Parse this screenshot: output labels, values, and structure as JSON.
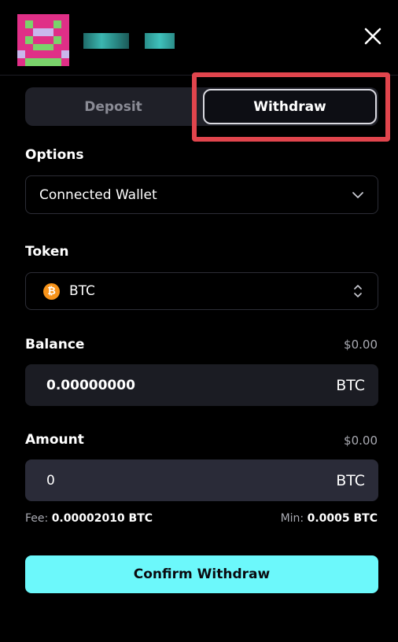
{
  "header": {
    "avatar_icon": "pixel-avatar-icon",
    "close_icon": "close-icon"
  },
  "tabs": [
    {
      "label": "Deposit",
      "active": false
    },
    {
      "label": "Withdraw",
      "active": true
    }
  ],
  "options": {
    "label": "Options",
    "selected": "Connected Wallet",
    "icon": "chevron-down-icon"
  },
  "token": {
    "label": "Token",
    "selected": "BTC",
    "icon": "bitcoin-icon",
    "selector_icon": "chevron-up-down-icon"
  },
  "balance": {
    "label": "Balance",
    "usd": "$0.00",
    "value": "0.00000000",
    "unit": "BTC"
  },
  "amount": {
    "label": "Amount",
    "usd": "$0.00",
    "value": "0",
    "unit": "BTC"
  },
  "fee": {
    "label": "Fee:",
    "value": "0.00002010 BTC"
  },
  "min": {
    "label": "Min:",
    "value": "0.0005 BTC"
  },
  "confirm_label": "Confirm Withdraw",
  "colors": {
    "accent": "#6cf8fb",
    "highlight": "#e1454d",
    "btc": "#f7931a"
  }
}
